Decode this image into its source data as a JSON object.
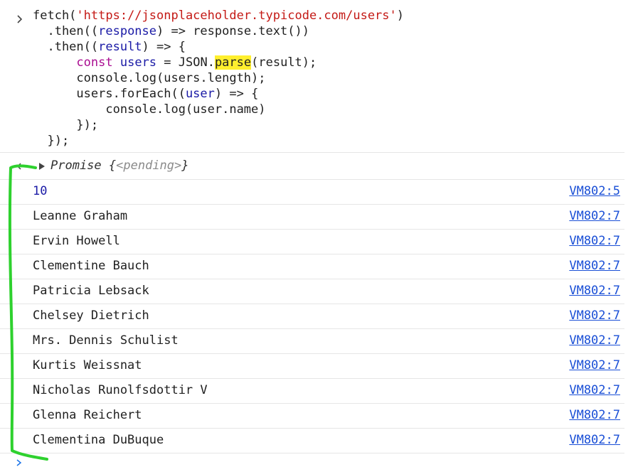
{
  "colors": {
    "string": "#c41a16",
    "variable": "#1a1aa6",
    "keyword": "#aa0d91",
    "highlight": "#ffef2e",
    "link": "#1a4fd6",
    "annotation": "#2ed12e"
  },
  "input": {
    "line1_fn": "fetch(",
    "line1_url": "'https://jsonplaceholder.typicode.com/users'",
    "line1_end": ")",
    "line2_a": "  .then((",
    "line2_var": "response",
    "line2_b": ") => response.text())",
    "line3_a": "  .then((",
    "line3_var": "result",
    "line3_b": ") => {",
    "line4_kw": "const",
    "line4_var": "users",
    "line4_a": " = JSON.",
    "line4_hl": "parse",
    "line4_b": "(result);",
    "line5": "      console.log(users.length);",
    "line6_a": "      users.forEach((",
    "line6_var": "user",
    "line6_b": ") => {",
    "line7": "          console.log(user.name)",
    "line8": "      });",
    "line9": "  });"
  },
  "result": {
    "label": "Promise ",
    "open": "{",
    "pending": "<pending>",
    "close": "}"
  },
  "logs": [
    {
      "text": "10",
      "source": "VM802:5"
    },
    {
      "text": "Leanne Graham",
      "source": "VM802:7"
    },
    {
      "text": "Ervin Howell",
      "source": "VM802:7"
    },
    {
      "text": "Clementine Bauch",
      "source": "VM802:7"
    },
    {
      "text": "Patricia Lebsack",
      "source": "VM802:7"
    },
    {
      "text": "Chelsey Dietrich",
      "source": "VM802:7"
    },
    {
      "text": "Mrs. Dennis Schulist",
      "source": "VM802:7"
    },
    {
      "text": "Kurtis Weissnat",
      "source": "VM802:7"
    },
    {
      "text": "Nicholas Runolfsdottir V",
      "source": "VM802:7"
    },
    {
      "text": "Glenna Reichert",
      "source": "VM802:7"
    },
    {
      "text": "Clementina DuBuque",
      "source": "VM802:7"
    }
  ]
}
